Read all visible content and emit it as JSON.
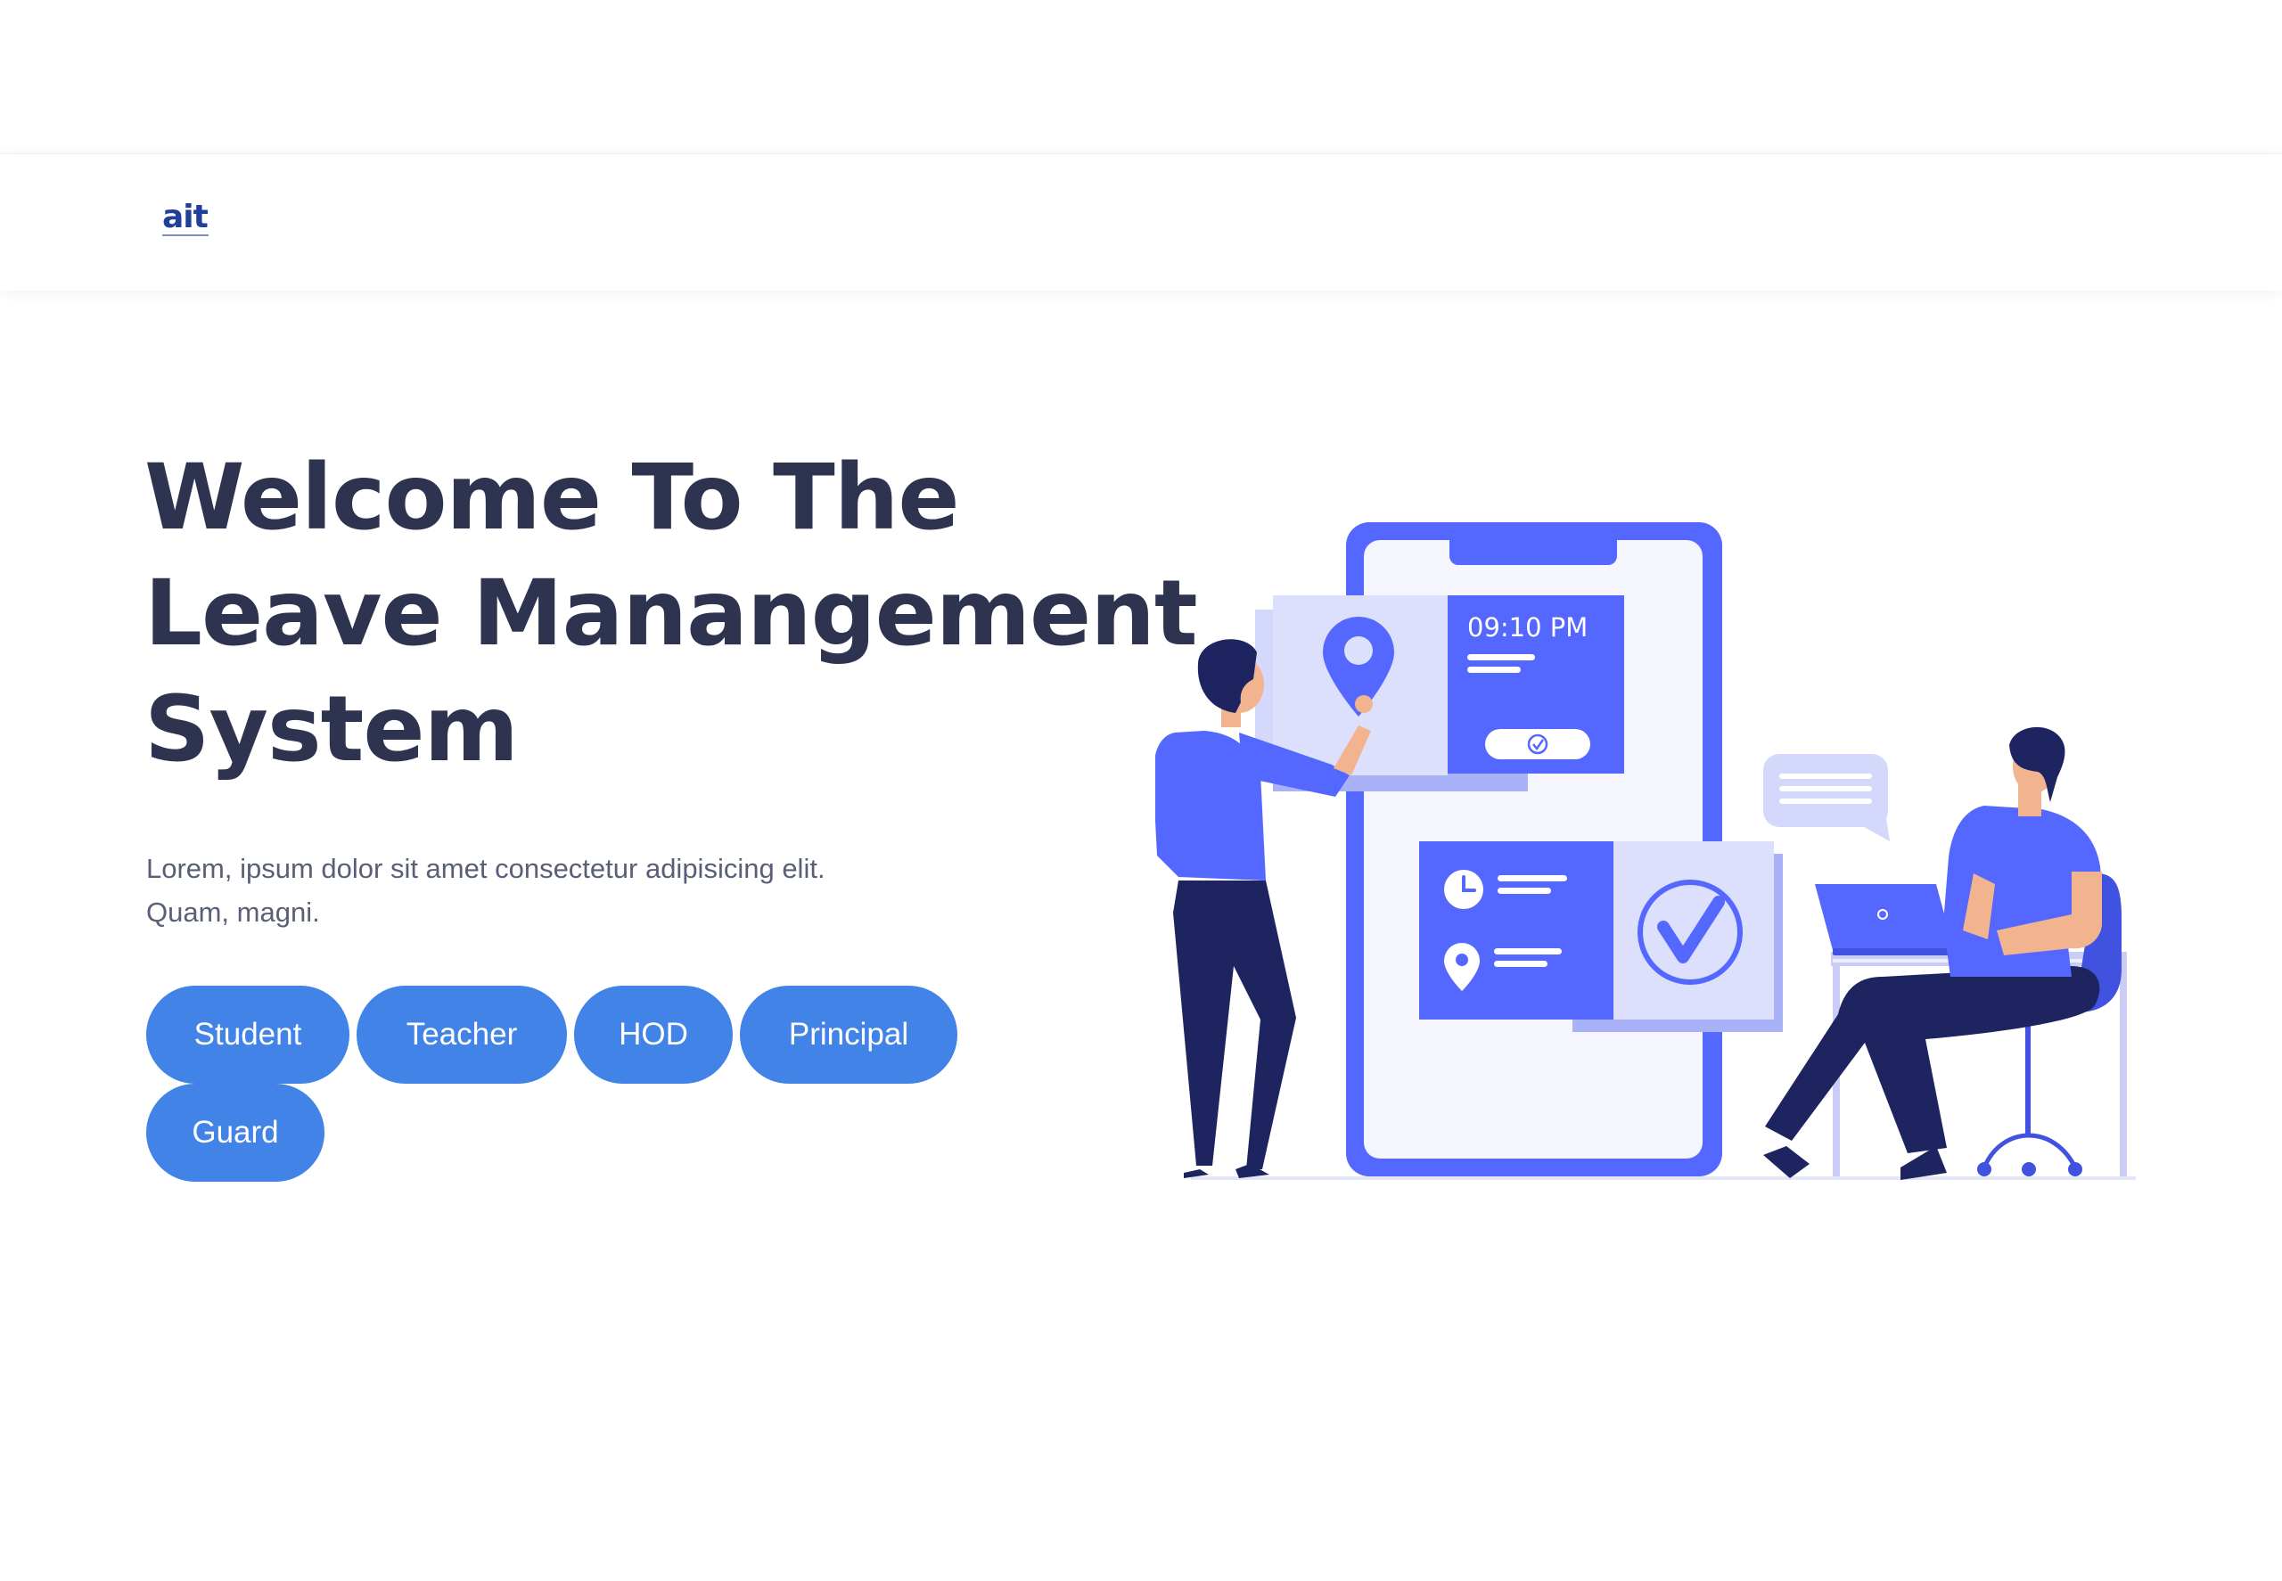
{
  "brand": {
    "logo_text": "ait"
  },
  "hero": {
    "title_lines": [
      "Welcome To The",
      "Leave Manangement",
      "System"
    ],
    "subtitle_lines": [
      "Lorem, ipsum dolor sit amet consectetur adipisicing elit.",
      "Quam, magni."
    ]
  },
  "roles": [
    "Student",
    "Teacher",
    "HOD",
    "Principal",
    "Guard"
  ],
  "illustration": {
    "time_text": "09:10 PM",
    "icons": [
      "location-pin-icon",
      "clock-icon",
      "check-circle-icon",
      "chat-bubble-icon",
      "laptop-icon"
    ]
  },
  "colors": {
    "button": "#4283e8",
    "heading": "#2e3350",
    "text": "#5a5f78",
    "accent": "#5468ff",
    "navy": "#1e2460",
    "skin": "#f1b48e"
  }
}
